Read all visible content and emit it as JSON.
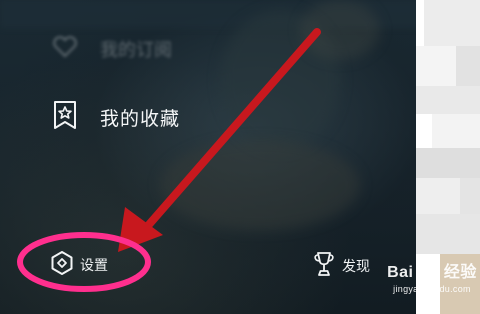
{
  "menu": {
    "subscriptions_label": "我的订阅",
    "favorites_label": "我的收藏",
    "settings_label": "设置",
    "discover_label": "发现"
  },
  "icons": {
    "subscriptions": "heart-icon",
    "favorites": "bookmark-star-icon",
    "settings": "hexagon-gear-icon",
    "discover": "trophy-icon"
  },
  "watermark": {
    "logo_text": "Bai du 经验",
    "url": "jingyan.baidu.com"
  },
  "colors": {
    "annotation_arrow": "#c8181e",
    "annotation_circle": "#ff2f8e",
    "drawer_bg": "#18252d"
  }
}
